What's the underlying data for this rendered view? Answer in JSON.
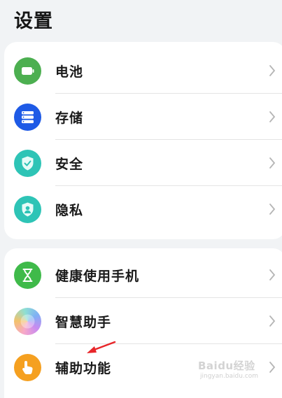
{
  "header": {
    "title": "设置"
  },
  "group1": {
    "items": [
      {
        "label": "电池",
        "icon": "battery-icon",
        "color": "#4caf50"
      },
      {
        "label": "存储",
        "icon": "storage-icon",
        "color": "#1e5ae6"
      },
      {
        "label": "安全",
        "icon": "shield-icon",
        "color": "#2ec4b6"
      },
      {
        "label": "隐私",
        "icon": "privacy-icon",
        "color": "#2ec4b6"
      }
    ]
  },
  "group2": {
    "items": [
      {
        "label": "健康使用手机",
        "icon": "hourglass-icon",
        "color": "#3fba4a"
      },
      {
        "label": "智慧助手",
        "icon": "assistant-icon",
        "color": "#c98bf0"
      },
      {
        "label": "辅助功能",
        "icon": "accessibility-icon",
        "color": "#f5a020"
      }
    ]
  },
  "watermark": {
    "text": "Baidu经验",
    "sub": "jingyan.baidu.com"
  },
  "annotation": {
    "arrow_color": "#e8262a"
  }
}
